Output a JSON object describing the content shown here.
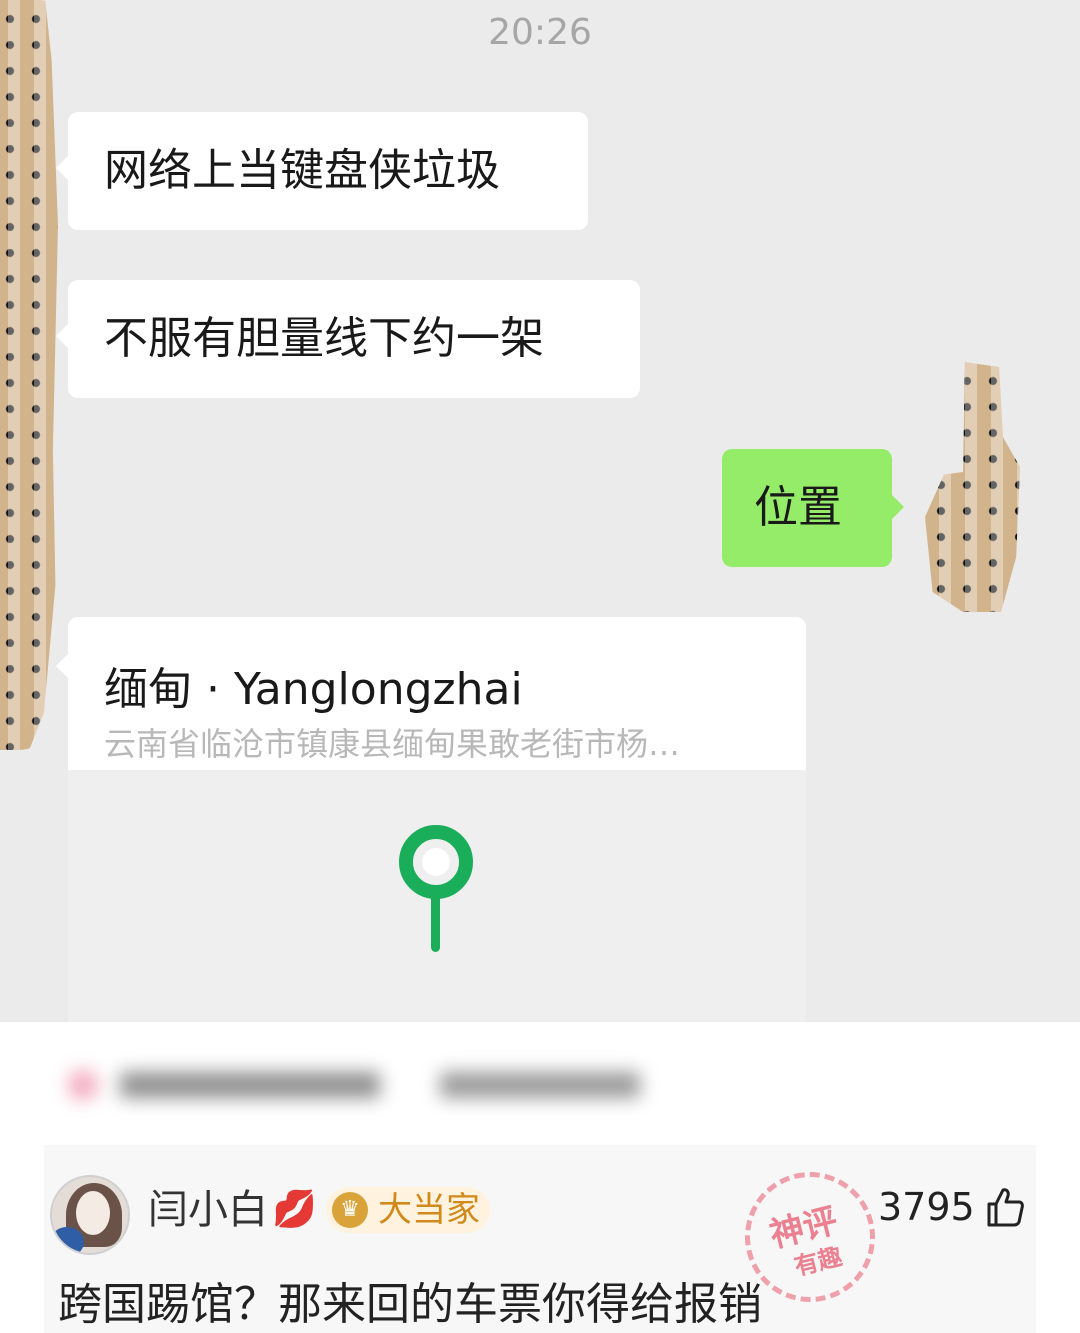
{
  "chat": {
    "time": "20:26",
    "messages": [
      {
        "side": "left",
        "text": "网络上当键盘侠垃圾"
      },
      {
        "side": "left",
        "text": "不服有胆量线下约一架"
      },
      {
        "side": "right",
        "text": "位置"
      }
    ],
    "location_card": {
      "title": "缅甸 · Yanglongzhai",
      "address": "云南省临沧市镇康县缅甸果敢老街市杨…",
      "pin_color": "#1aad5a"
    }
  },
  "comment": {
    "username": "闫小白",
    "badge_label": "大当家",
    "likes": "3795",
    "text": "跨国踢馆？那来回的车票你得给报销",
    "stamp_line1": "神评",
    "stamp_line2": "有趣"
  },
  "colors": {
    "chat_bg": "#ebebeb",
    "bubble_out": "#95ec69",
    "bubble_in": "#ffffff",
    "badge_text": "#d18a1a"
  }
}
